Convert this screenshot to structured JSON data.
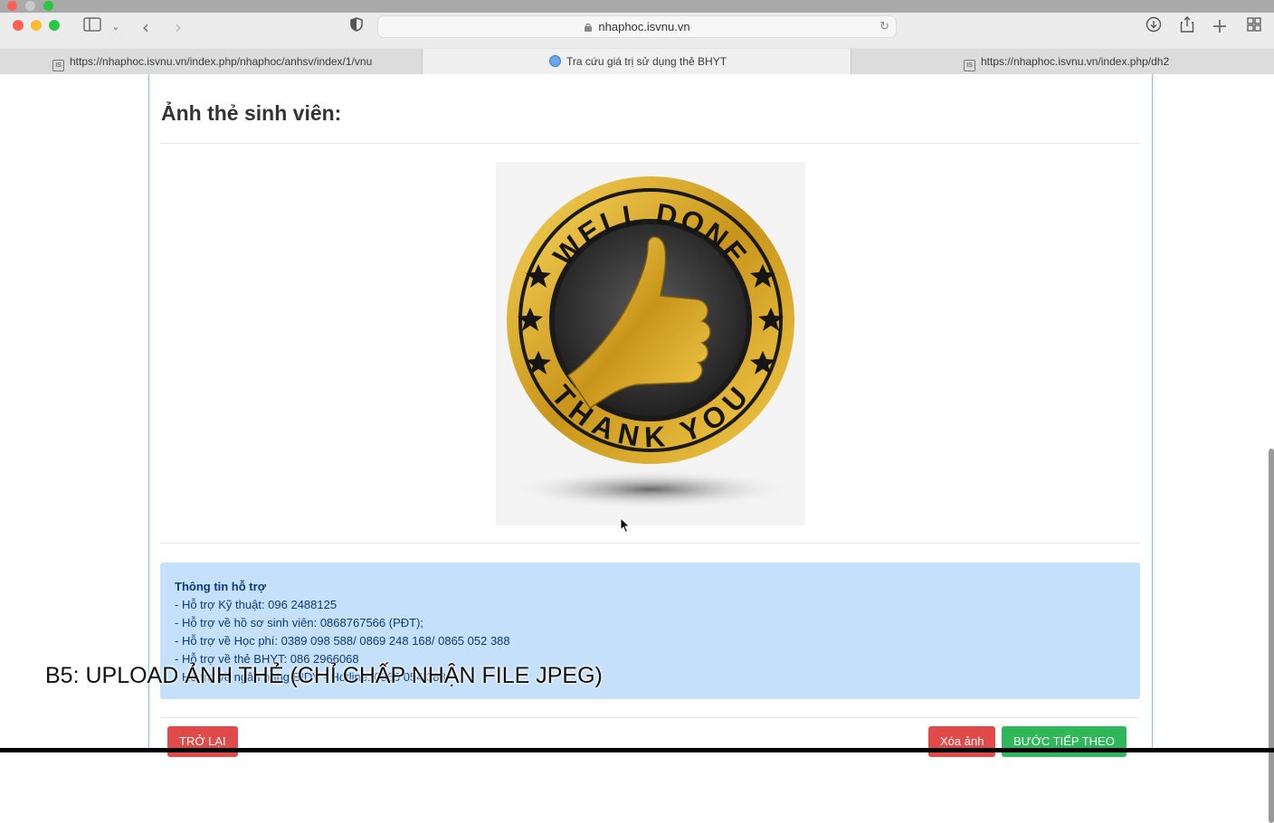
{
  "browser": {
    "address": "nhaphoc.isvnu.vn",
    "tabs": [
      {
        "label": "https://nhaphoc.isvnu.vn/index.php/nhaphoc/anhsv/index/1/vnu",
        "favicon": "IS"
      },
      {
        "label": "Tra cứu giá trị sử dụng thẻ BHYT",
        "favicon": "globe"
      },
      {
        "label": "https://nhaphoc.isvnu.vn/index.php/dh2",
        "favicon": "IS"
      }
    ],
    "active_tab": 1
  },
  "page": {
    "title": "Ảnh thẻ sinh viên:",
    "photo": {
      "top_text": "WELL DONE",
      "bottom_text": "THANK YOU"
    },
    "support": {
      "heading": "Thông tin hỗ trợ",
      "lines": [
        "- Hỗ trợ Kỹ thuật: 096 2488125",
        "- Hỗ trợ về hồ sơ sinh viên: 0868767566 (PĐT);",
        "- Hỗ trợ về Học phí: 0389 098 588/ 0869 248 168/ 0865 052 388",
        "- Hỗ trợ về thẻ BHYT: 086 2966068",
        "- Hỗ trợ về ngân hàng BIDV - Hotline: 0865 054 388"
      ]
    },
    "buttons": {
      "back": "TRỞ LẠI",
      "delete": "Xóa ảnh",
      "next": "BƯỚC TIẾP THEO"
    }
  },
  "caption": "B5: UPLOAD ẢNH THẺ (CHỈ CHẤP NHẬN FILE JPEG)",
  "colors": {
    "panel_border": "#8cbde6",
    "support_bg": "#c4e0fb",
    "support_text": "#0e3a75",
    "btn_red": "#e04a48",
    "btn_green": "#2fb85a"
  }
}
